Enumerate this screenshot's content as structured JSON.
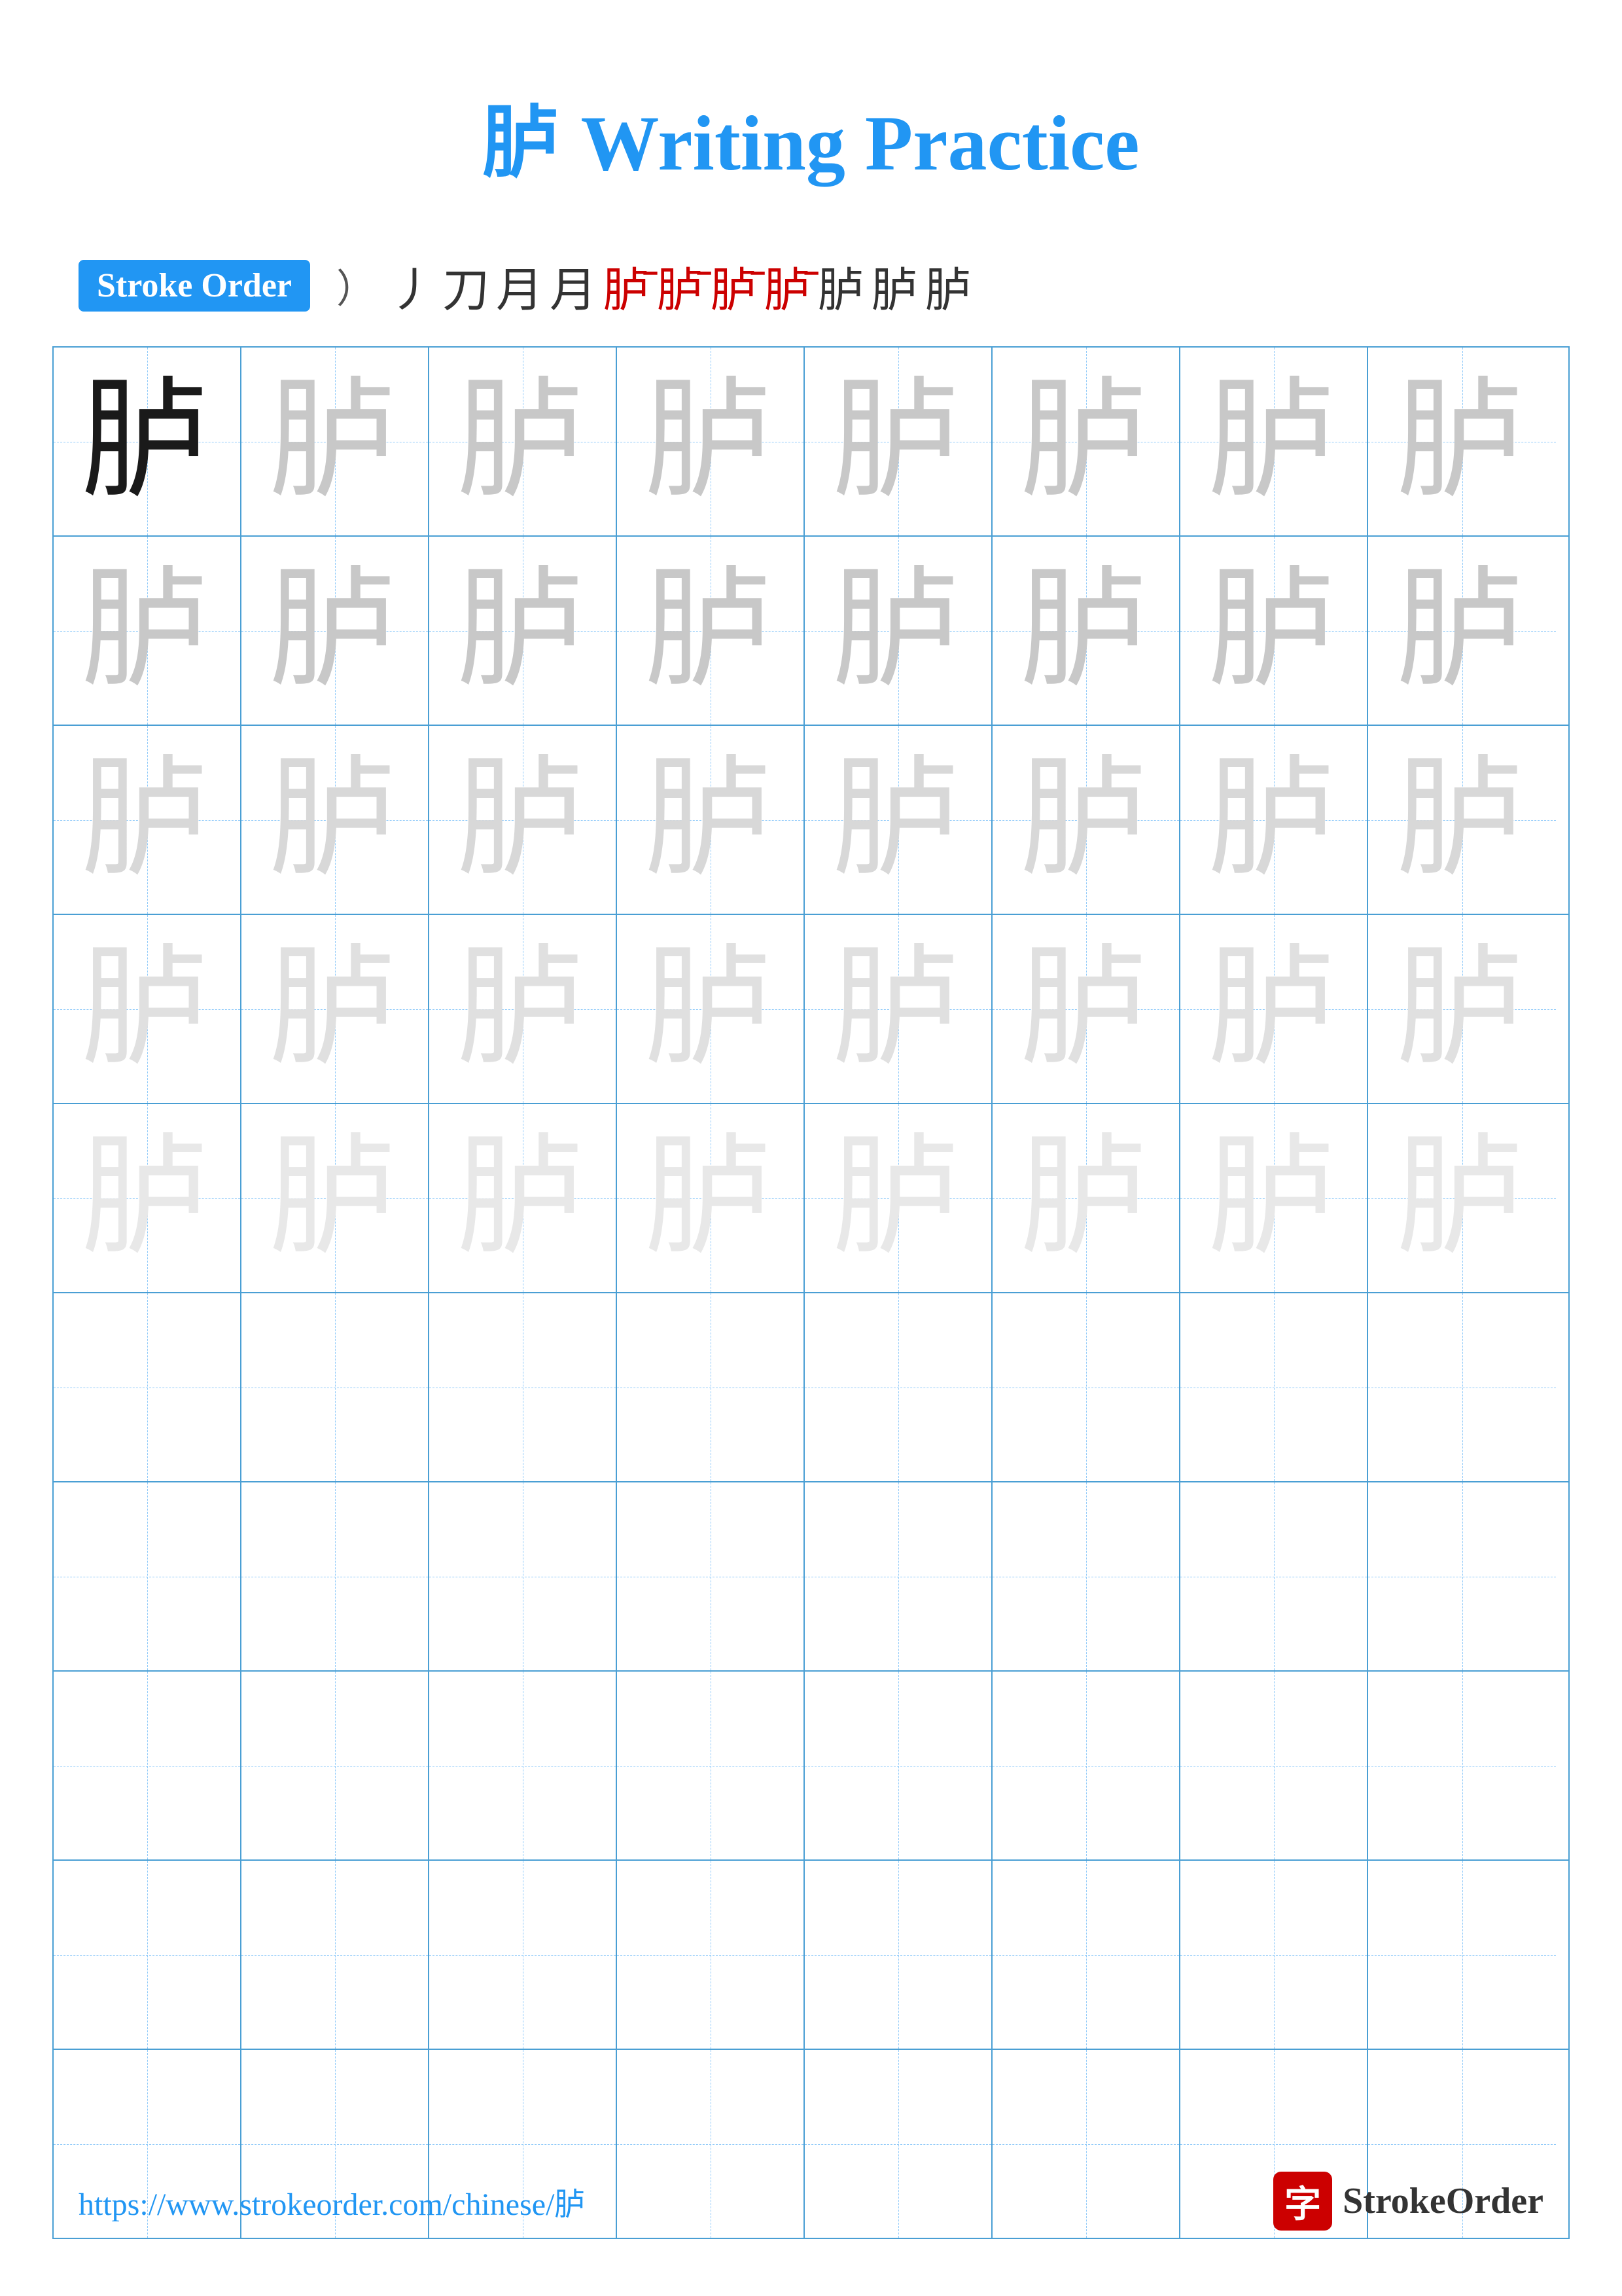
{
  "page": {
    "title_char": "胪",
    "title_text": " Writing Practice",
    "stroke_order_label": "Stroke Order",
    "stroke_sequence": [
      "丿",
      "刀",
      "月",
      "月",
      "胪⁻",
      "胪⁻",
      "胪⁻",
      "胪⁻",
      "胪",
      "胪",
      "胪"
    ],
    "character": "胪",
    "url": "https://www.strokeorder.com/chinese/胪",
    "logo_text": "StrokeOrder",
    "logo_char": "字",
    "rows": [
      {
        "cells": [
          "dark",
          "light1",
          "light1",
          "light1",
          "light1",
          "light1",
          "light1",
          "light1"
        ]
      },
      {
        "cells": [
          "light1",
          "light1",
          "light1",
          "light1",
          "light1",
          "light1",
          "light1",
          "light1"
        ]
      },
      {
        "cells": [
          "light2",
          "light2",
          "light2",
          "light2",
          "light2",
          "light2",
          "light2",
          "light2"
        ]
      },
      {
        "cells": [
          "light3",
          "light3",
          "light3",
          "light3",
          "light3",
          "light3",
          "light3",
          "light3"
        ]
      },
      {
        "cells": [
          "light4",
          "light4",
          "light4",
          "light4",
          "light4",
          "light4",
          "light4",
          "light4"
        ]
      },
      {
        "cells": [
          "empty",
          "empty",
          "empty",
          "empty",
          "empty",
          "empty",
          "empty",
          "empty"
        ]
      },
      {
        "cells": [
          "empty",
          "empty",
          "empty",
          "empty",
          "empty",
          "empty",
          "empty",
          "empty"
        ]
      },
      {
        "cells": [
          "empty",
          "empty",
          "empty",
          "empty",
          "empty",
          "empty",
          "empty",
          "empty"
        ]
      },
      {
        "cells": [
          "empty",
          "empty",
          "empty",
          "empty",
          "empty",
          "empty",
          "empty",
          "empty"
        ]
      },
      {
        "cells": [
          "empty",
          "empty",
          "empty",
          "empty",
          "empty",
          "empty",
          "empty",
          "empty"
        ]
      }
    ]
  }
}
